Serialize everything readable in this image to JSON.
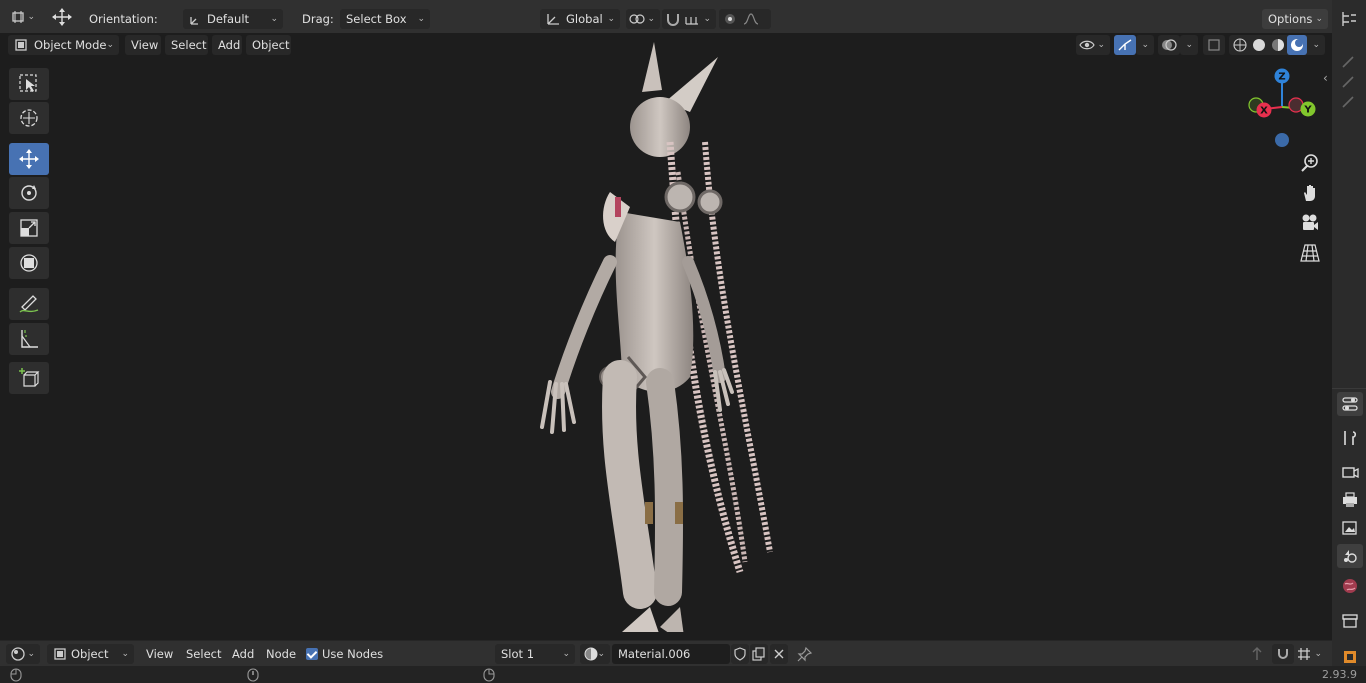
{
  "tool_header": {
    "orientation_label": "Orientation:",
    "orientation_value": "Default",
    "drag_label": "Drag:",
    "drag_value": "Select Box",
    "transform_orientation": "Global",
    "options_label": "Options"
  },
  "view_header": {
    "mode": "Object Mode",
    "menus": [
      "View",
      "Select",
      "Add",
      "Object"
    ]
  },
  "navigation_gizmo": {
    "axes": [
      "Z",
      "X",
      "Y"
    ],
    "colors": {
      "x": "#e8304e",
      "y": "#82c72d",
      "z": "#2f83d9",
      "neg": "#3b6aa8"
    }
  },
  "toolbar": {
    "tools": [
      "select-box",
      "cursor",
      "move",
      "rotate",
      "scale",
      "transform",
      "annotate",
      "measure",
      "add-cube"
    ],
    "active_tool": "move"
  },
  "shader_header": {
    "editor_mode": "Object",
    "menus": [
      "View",
      "Select",
      "Add",
      "Node"
    ],
    "use_nodes_label": "Use Nodes",
    "use_nodes_checked": true,
    "slot": "Slot 1",
    "material": "Material.006"
  },
  "status_bar": {
    "version": "2.93.9"
  },
  "colors": {
    "accent": "#4772b3",
    "header_bg": "#303030",
    "viewport_bg": "#1d1d1d"
  }
}
